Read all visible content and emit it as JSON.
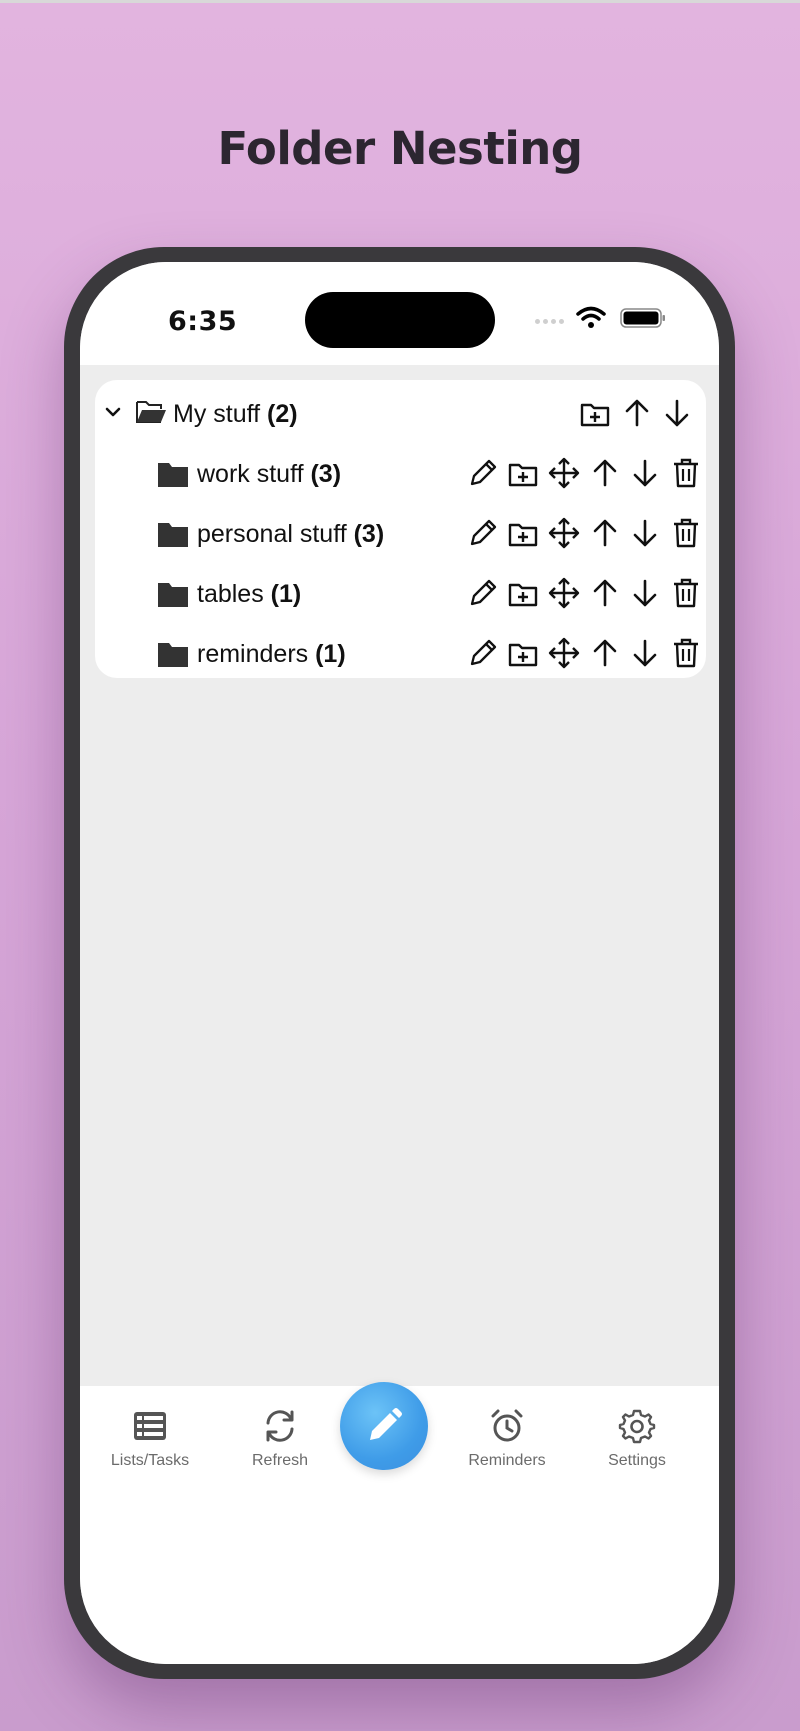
{
  "page_title": "Folder Nesting",
  "status_bar": {
    "time": "6:35"
  },
  "tree": {
    "root": {
      "name": "My stuff",
      "count": "(2)"
    },
    "children": [
      {
        "name": "work stuff",
        "count": "(3)"
      },
      {
        "name": "personal stuff",
        "count": "(3)"
      },
      {
        "name": "tables",
        "count": "(1)"
      },
      {
        "name": "reminders",
        "count": "(1)"
      }
    ]
  },
  "tabbar": {
    "lists_label": "Lists/Tasks",
    "refresh_label": "Refresh",
    "reminders_label": "Reminders",
    "settings_label": "Settings"
  },
  "colors": {
    "background": "#d9a9d9",
    "fab": "#4aa6ec",
    "icon": "#111111",
    "folder": "#333333"
  }
}
